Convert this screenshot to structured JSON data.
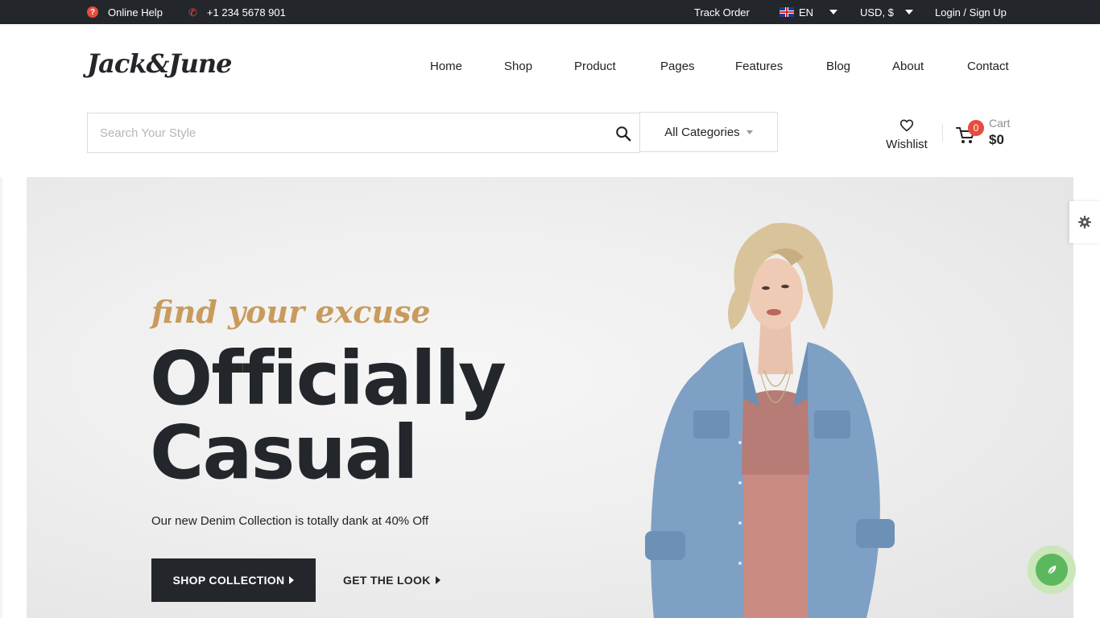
{
  "topbar": {
    "online_help": "Online Help",
    "phone": "+1 234 5678 901",
    "track_order": "Track Order",
    "language": "EN",
    "currency": "USD, $",
    "login": "Login / Sign Up"
  },
  "header": {
    "logo_text": "Jack&June",
    "nav": [
      "Home",
      "Shop",
      "Product",
      "Pages",
      "Features",
      "Blog",
      "About",
      "Contact"
    ]
  },
  "search": {
    "placeholder": "Search Your Style",
    "value": "",
    "category": "All Categories"
  },
  "wishlist": {
    "label": "Wishlist"
  },
  "cart": {
    "label": "Cart",
    "count": "0",
    "total": "$0"
  },
  "hero": {
    "kicker": "find your excuse",
    "headline_line1": "Officially",
    "headline_line2": "Casual",
    "subtext": "Our new Denim Collection is totally dank at 40% Off",
    "primary_button": "SHOP COLLECTION",
    "secondary_button": "GET THE LOOK"
  },
  "colors": {
    "topbar_bg": "#23272b",
    "accent_red": "#e74c3c",
    "kicker_gold": "#c89b5d",
    "dark_text": "#23272b",
    "fab_green": "#5cb85c"
  },
  "icons": [
    "help-icon",
    "phone-icon",
    "uk-flag-icon",
    "caret-down-icon",
    "search-icon",
    "heart-icon",
    "cart-icon",
    "gear-icon",
    "leaf-icon"
  ]
}
